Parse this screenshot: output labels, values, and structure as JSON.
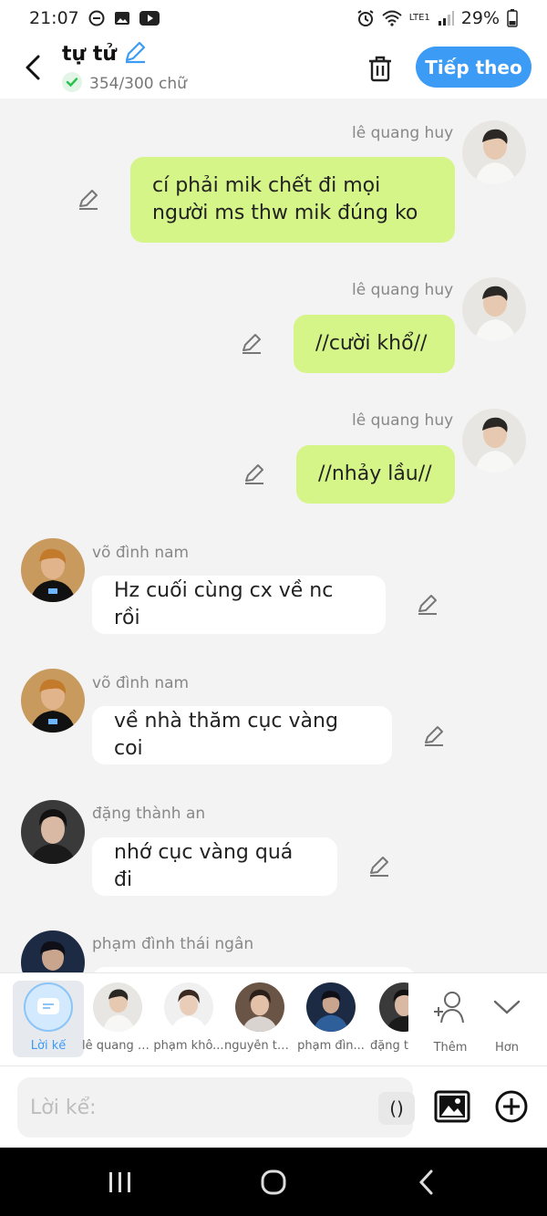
{
  "status": {
    "time": "21:07",
    "battery": "29%",
    "network": "LTE1"
  },
  "header": {
    "title": "tự tử",
    "char_count": "354/300 chữ",
    "next_label": "Tiếp theo"
  },
  "messages": [
    {
      "name": "lê quang huy",
      "text_line1": "cí phải mik chết đi mọi",
      "text_line2": "người ms thw mik đúng ko"
    },
    {
      "name": "lê quang huy",
      "text": "//cười khổ//"
    },
    {
      "name": "lê quang huy",
      "text": "//nhảy lầu//"
    },
    {
      "name": "võ đình nam",
      "text": "Hz cuối cùng cx về nc rồi"
    },
    {
      "name": "võ đình nam",
      "text": "về nhà thăm cục vàng coi"
    },
    {
      "name": "đặng thành an",
      "text": "nhớ cục vàng quá đi"
    },
    {
      "name": "phạm đình thái ngân"
    }
  ],
  "selector": {
    "narration_label": "Lời kể",
    "items": [
      {
        "label": "lê quang h..."
      },
      {
        "label": "phạm khô..."
      },
      {
        "label": "nguyễn th..."
      },
      {
        "label": "phạm đìn..."
      },
      {
        "label": "đặng t"
      }
    ],
    "more_label": "Thêm",
    "collapse_label": "Hơn"
  },
  "input": {
    "placeholder": "Lời kể:",
    "paren_label": "()"
  },
  "colors": {
    "accent": "#3c9bf5",
    "bubble_out": "#d6f589",
    "bubble_in": "#ffffff"
  }
}
